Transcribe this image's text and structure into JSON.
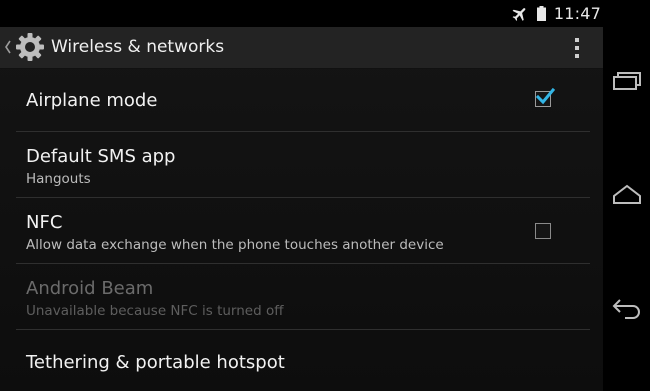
{
  "status_bar": {
    "time": "11:47",
    "icons": [
      "airplane-mode-icon",
      "battery-icon"
    ]
  },
  "action_bar": {
    "title": "Wireless & networks",
    "icon": "settings-gear-icon",
    "up_icon": "chevron-left-icon",
    "overflow_icon": "overflow-menu-icon"
  },
  "settings": {
    "items": [
      {
        "title": "Airplane mode",
        "subtitle": "",
        "checkbox": true,
        "checked": true,
        "enabled": true
      },
      {
        "title": "Default SMS app",
        "subtitle": "Hangouts",
        "checkbox": false,
        "enabled": true
      },
      {
        "title": "NFC",
        "subtitle": "Allow data exchange when the phone touches another device",
        "checkbox": true,
        "checked": false,
        "enabled": true
      },
      {
        "title": "Android Beam",
        "subtitle": "Unavailable because NFC is turned off",
        "checkbox": false,
        "enabled": false
      },
      {
        "title": "Tethering & portable hotspot",
        "subtitle": "",
        "checkbox": false,
        "enabled": true
      }
    ]
  },
  "nav_bar": {
    "buttons": [
      "recent-apps-icon",
      "home-icon",
      "back-icon"
    ]
  },
  "colors": {
    "accent": "#33b5e5",
    "background": "#0d0d0d",
    "action_bar": "#232323"
  }
}
